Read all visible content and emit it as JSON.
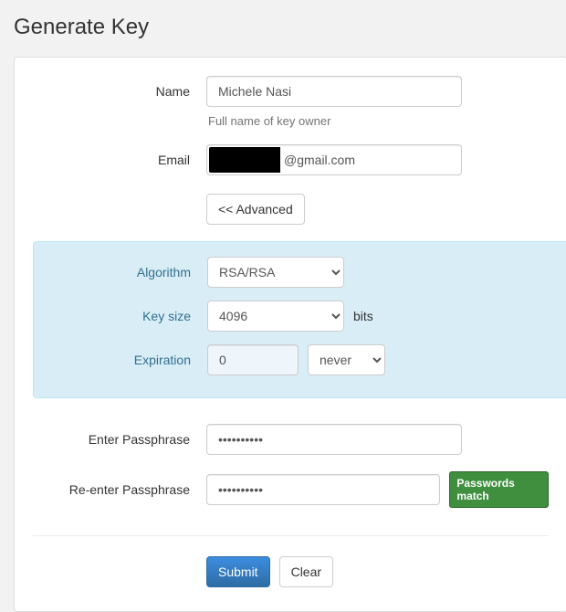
{
  "title": "Generate Key",
  "name": {
    "label": "Name",
    "value": "Michele Nasi",
    "help": "Full name of key owner"
  },
  "email": {
    "label": "Email",
    "value_visible_part": "@gmail.com"
  },
  "advanced_toggle_label": "<< Advanced",
  "algorithm": {
    "label": "Algorithm",
    "value": "RSA/RSA"
  },
  "keysize": {
    "label": "Key size",
    "value": "4096",
    "unit": "bits"
  },
  "expiration": {
    "label": "Expiration",
    "value": "0",
    "unit_value": "never"
  },
  "passphrase": {
    "enter_label": "Enter Passphrase",
    "reenter_label": "Re-enter Passphrase",
    "enter_value": "••••••••••",
    "reenter_value": "••••••••••",
    "match_badge": "Passwords match"
  },
  "actions": {
    "submit": "Submit",
    "clear": "Clear"
  }
}
